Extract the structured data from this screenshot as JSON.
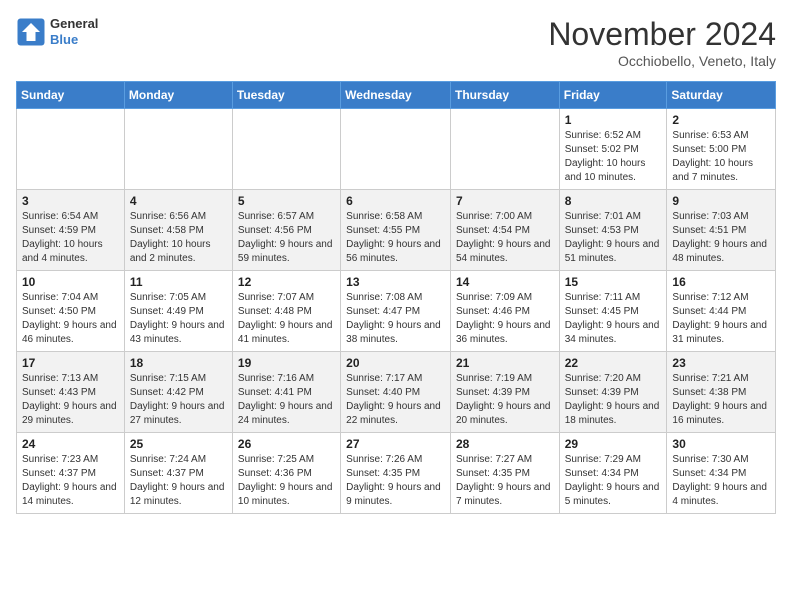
{
  "logo": {
    "text_top": "General",
    "text_bottom": "Blue"
  },
  "title": "November 2024",
  "location": "Occhiobello, Veneto, Italy",
  "days_of_week": [
    "Sunday",
    "Monday",
    "Tuesday",
    "Wednesday",
    "Thursday",
    "Friday",
    "Saturday"
  ],
  "weeks": [
    [
      {
        "day": "",
        "info": ""
      },
      {
        "day": "",
        "info": ""
      },
      {
        "day": "",
        "info": ""
      },
      {
        "day": "",
        "info": ""
      },
      {
        "day": "",
        "info": ""
      },
      {
        "day": "1",
        "info": "Sunrise: 6:52 AM\nSunset: 5:02 PM\nDaylight: 10 hours and 10 minutes."
      },
      {
        "day": "2",
        "info": "Sunrise: 6:53 AM\nSunset: 5:00 PM\nDaylight: 10 hours and 7 minutes."
      }
    ],
    [
      {
        "day": "3",
        "info": "Sunrise: 6:54 AM\nSunset: 4:59 PM\nDaylight: 10 hours and 4 minutes."
      },
      {
        "day": "4",
        "info": "Sunrise: 6:56 AM\nSunset: 4:58 PM\nDaylight: 10 hours and 2 minutes."
      },
      {
        "day": "5",
        "info": "Sunrise: 6:57 AM\nSunset: 4:56 PM\nDaylight: 9 hours and 59 minutes."
      },
      {
        "day": "6",
        "info": "Sunrise: 6:58 AM\nSunset: 4:55 PM\nDaylight: 9 hours and 56 minutes."
      },
      {
        "day": "7",
        "info": "Sunrise: 7:00 AM\nSunset: 4:54 PM\nDaylight: 9 hours and 54 minutes."
      },
      {
        "day": "8",
        "info": "Sunrise: 7:01 AM\nSunset: 4:53 PM\nDaylight: 9 hours and 51 minutes."
      },
      {
        "day": "9",
        "info": "Sunrise: 7:03 AM\nSunset: 4:51 PM\nDaylight: 9 hours and 48 minutes."
      }
    ],
    [
      {
        "day": "10",
        "info": "Sunrise: 7:04 AM\nSunset: 4:50 PM\nDaylight: 9 hours and 46 minutes."
      },
      {
        "day": "11",
        "info": "Sunrise: 7:05 AM\nSunset: 4:49 PM\nDaylight: 9 hours and 43 minutes."
      },
      {
        "day": "12",
        "info": "Sunrise: 7:07 AM\nSunset: 4:48 PM\nDaylight: 9 hours and 41 minutes."
      },
      {
        "day": "13",
        "info": "Sunrise: 7:08 AM\nSunset: 4:47 PM\nDaylight: 9 hours and 38 minutes."
      },
      {
        "day": "14",
        "info": "Sunrise: 7:09 AM\nSunset: 4:46 PM\nDaylight: 9 hours and 36 minutes."
      },
      {
        "day": "15",
        "info": "Sunrise: 7:11 AM\nSunset: 4:45 PM\nDaylight: 9 hours and 34 minutes."
      },
      {
        "day": "16",
        "info": "Sunrise: 7:12 AM\nSunset: 4:44 PM\nDaylight: 9 hours and 31 minutes."
      }
    ],
    [
      {
        "day": "17",
        "info": "Sunrise: 7:13 AM\nSunset: 4:43 PM\nDaylight: 9 hours and 29 minutes."
      },
      {
        "day": "18",
        "info": "Sunrise: 7:15 AM\nSunset: 4:42 PM\nDaylight: 9 hours and 27 minutes."
      },
      {
        "day": "19",
        "info": "Sunrise: 7:16 AM\nSunset: 4:41 PM\nDaylight: 9 hours and 24 minutes."
      },
      {
        "day": "20",
        "info": "Sunrise: 7:17 AM\nSunset: 4:40 PM\nDaylight: 9 hours and 22 minutes."
      },
      {
        "day": "21",
        "info": "Sunrise: 7:19 AM\nSunset: 4:39 PM\nDaylight: 9 hours and 20 minutes."
      },
      {
        "day": "22",
        "info": "Sunrise: 7:20 AM\nSunset: 4:39 PM\nDaylight: 9 hours and 18 minutes."
      },
      {
        "day": "23",
        "info": "Sunrise: 7:21 AM\nSunset: 4:38 PM\nDaylight: 9 hours and 16 minutes."
      }
    ],
    [
      {
        "day": "24",
        "info": "Sunrise: 7:23 AM\nSunset: 4:37 PM\nDaylight: 9 hours and 14 minutes."
      },
      {
        "day": "25",
        "info": "Sunrise: 7:24 AM\nSunset: 4:37 PM\nDaylight: 9 hours and 12 minutes."
      },
      {
        "day": "26",
        "info": "Sunrise: 7:25 AM\nSunset: 4:36 PM\nDaylight: 9 hours and 10 minutes."
      },
      {
        "day": "27",
        "info": "Sunrise: 7:26 AM\nSunset: 4:35 PM\nDaylight: 9 hours and 9 minutes."
      },
      {
        "day": "28",
        "info": "Sunrise: 7:27 AM\nSunset: 4:35 PM\nDaylight: 9 hours and 7 minutes."
      },
      {
        "day": "29",
        "info": "Sunrise: 7:29 AM\nSunset: 4:34 PM\nDaylight: 9 hours and 5 minutes."
      },
      {
        "day": "30",
        "info": "Sunrise: 7:30 AM\nSunset: 4:34 PM\nDaylight: 9 hours and 4 minutes."
      }
    ]
  ]
}
